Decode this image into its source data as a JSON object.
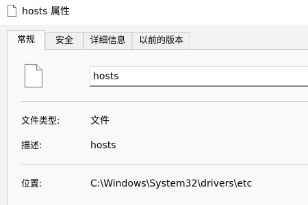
{
  "window": {
    "title": "hosts 属性"
  },
  "tabs": [
    {
      "label": "常规"
    },
    {
      "label": "安全"
    },
    {
      "label": "详细信息"
    },
    {
      "label": "以前的版本"
    }
  ],
  "general": {
    "file_name": "hosts",
    "fields": [
      {
        "label": "文件类型:",
        "value": "文件"
      },
      {
        "label": "描述:",
        "value": "hosts"
      },
      {
        "label": "位置:",
        "value": "C:\\Windows\\System32\\drivers\\etc"
      }
    ]
  },
  "icons": {
    "title": "document-icon",
    "file": "document-icon"
  }
}
